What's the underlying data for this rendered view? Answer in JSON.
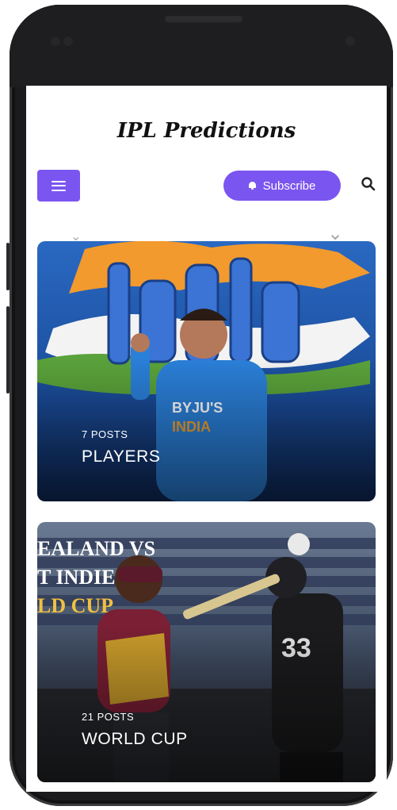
{
  "site": {
    "title": "IPL Predictions"
  },
  "header": {
    "menu_icon": "hamburger-icon",
    "subscribe_label": "Subscribe",
    "subscribe_icon": "bell-icon",
    "search_icon": "search-icon"
  },
  "colors": {
    "accent": "#7b55f0",
    "card1_bg": "#1e4fa0",
    "card2_bg": "#3a4458"
  },
  "categories": [
    {
      "count": "7 POSTS",
      "name": "PLAYERS",
      "banner_text": "india",
      "jersey_text": "BYJU'S INDIA"
    },
    {
      "count": "21 POSTS",
      "name": "WORLD CUP",
      "banner_lines": [
        "EALAND VS",
        "T INDIES",
        "LD CUP"
      ],
      "jersey_number": "33"
    }
  ]
}
